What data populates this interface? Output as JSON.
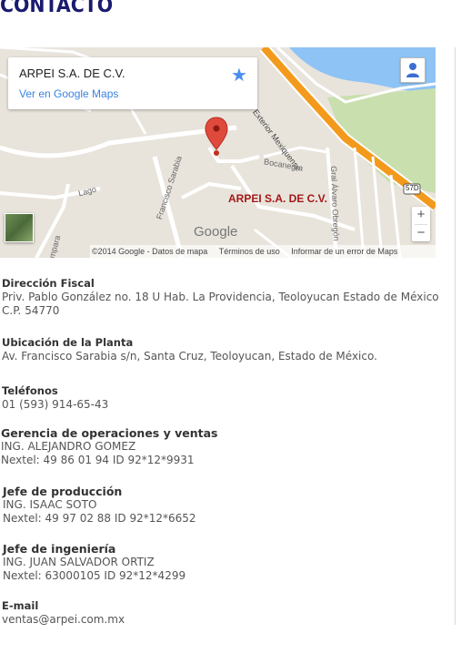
{
  "page": {
    "title": "CONTACTO"
  },
  "map": {
    "card_title": "ARPEI S.A. DE C.V.",
    "card_link": "Ver en Google Maps",
    "marker_label": "ARPEI S.A. DE C.V.",
    "logo": "Google",
    "footer": {
      "copyright": "©2014 Google - Datos de mapa",
      "terms": "Términos de uso",
      "report": "Informar de un error de Maps"
    },
    "streets": {
      "circuito": "ircuito Exterior Mexiquense",
      "bocanegra": "Bocanegra",
      "francisco": "Francisco Sarabia",
      "lago": "Lago",
      "alvaro": "Gral Álvaro Obregón",
      "mpara": "mpara",
      "shield": "57D"
    },
    "zoom_in": "+",
    "zoom_out": "−",
    "icons": [
      "star-icon",
      "pegman-icon",
      "map-pin-icon",
      "satellite-thumbnail"
    ]
  },
  "contact": {
    "fiscal": {
      "label": "Dirección Fiscal",
      "line1": "Priv. Pablo González no. 18 U Hab. La Providencia, Teoloyucan Estado de México",
      "line2": "C.P. 54770"
    },
    "planta": {
      "label": "Ubicación de la Planta",
      "line1": "Av. Francisco Sarabia s/n, Santa Cruz, Teoloyucan, Estado de México."
    },
    "telefonos": {
      "label": "Teléfonos",
      "line1": "01 (593) 914-65-43"
    },
    "gerencia": {
      "label": "Gerencia de operaciones y ventas",
      "name": "ING. ALEJANDRO GOMEZ",
      "nextel": "Nextel: 49 86 01 94  ID 92*12*9931"
    },
    "produccion": {
      "label": "Jefe de producción",
      "name": "ING. ISAAC SOTO",
      "nextel": "Nextel: 49 97 02 88 ID 92*12*6652"
    },
    "ingenieria": {
      "label": "Jefe de ingeniería",
      "name": "ING. JUAN SALVADOR ORTIZ",
      "nextel": "Nextel: 63000105 ID 92*12*4299"
    },
    "email": {
      "label": "E-mail",
      "value": "ventas@arpei.com.mx"
    }
  },
  "colors": {
    "title": "#1a1a6e",
    "link": "#3a84df",
    "marker": "#a51717",
    "highway": "#f39a1c",
    "water": "#8ec3f5",
    "park": "#c9dfae"
  }
}
